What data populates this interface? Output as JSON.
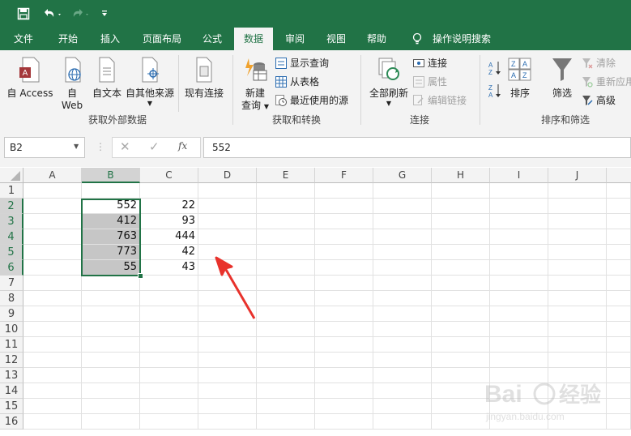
{
  "ribbon_tabs": [
    "文件",
    "开始",
    "插入",
    "页面布局",
    "公式",
    "数据",
    "审阅",
    "视图",
    "帮助",
    "操作说明搜索"
  ],
  "active_tab": "数据",
  "groups": {
    "external": {
      "label": "获取外部数据",
      "access": "自 Access",
      "web_1": "自",
      "web_2": "Web",
      "text": "自文本",
      "other": "自其他来源",
      "existing": "现有连接"
    },
    "transform": {
      "label": "获取和转换",
      "new_query_1": "新建",
      "new_query_2": "查询",
      "show_queries": "显示查询",
      "from_table": "从表格",
      "recent_sources": "最近使用的源"
    },
    "connections": {
      "label": "连接",
      "refresh_all": "全部刷新",
      "connections": "连接",
      "properties": "属性",
      "edit_links": "编辑链接"
    },
    "sort_filter": {
      "label": "排序和筛选",
      "sort": "排序",
      "filter": "筛选",
      "clear": "清除",
      "reapply": "重新应用",
      "advanced": "高级"
    }
  },
  "formula_bar": {
    "name_box": "B2",
    "fx": "fx",
    "value": "552"
  },
  "grid": {
    "columns": [
      "A",
      "B",
      "C",
      "D",
      "E",
      "F",
      "G",
      "H",
      "I",
      "J"
    ],
    "rows": [
      "1",
      "2",
      "3",
      "4",
      "5",
      "6",
      "7",
      "8",
      "9",
      "10",
      "11",
      "12",
      "13",
      "14",
      "15",
      "16"
    ],
    "colB": [
      "552",
      "412",
      "763",
      "773",
      "55"
    ],
    "colC": [
      "22",
      "93",
      "444",
      "42",
      "43"
    ]
  },
  "colors": {
    "accent": "#217346",
    "arrow": "#e8322c",
    "selection_fill": "#c6c6c6"
  }
}
